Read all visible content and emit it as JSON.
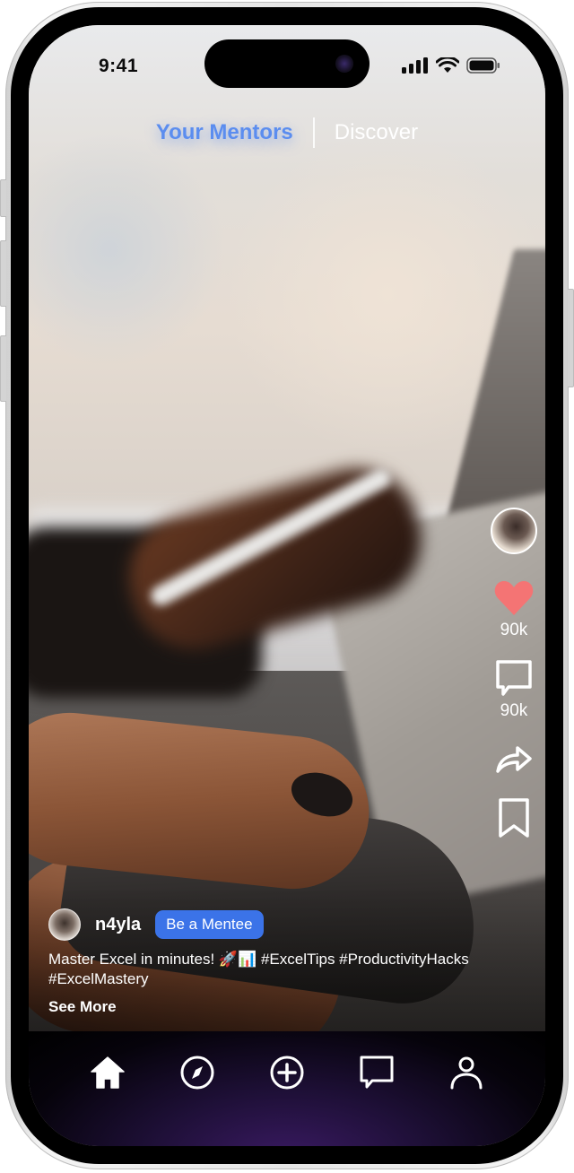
{
  "status_bar": {
    "time": "9:41"
  },
  "top_tabs": [
    {
      "label": "Your Mentors",
      "active": true
    },
    {
      "label": "Discover",
      "active": false
    }
  ],
  "actions": {
    "creator_avatar": "creator-avatar",
    "like": {
      "icon": "heart-icon",
      "count": "90k",
      "color": "#f47474"
    },
    "comment": {
      "icon": "comment-icon",
      "count": "90k"
    },
    "share": {
      "icon": "share-icon"
    },
    "bookmark": {
      "icon": "bookmark-icon"
    }
  },
  "post": {
    "author": "n4yla",
    "follow_button": "Be a Mentee",
    "caption": "Master Excel in minutes! 🚀📊 #ExcelTips #ProductivityHacks #ExcelMastery",
    "see_more": "See More"
  },
  "bottom_nav": [
    {
      "name": "home",
      "icon": "home-icon",
      "active": true
    },
    {
      "name": "discover",
      "icon": "compass-icon"
    },
    {
      "name": "create",
      "icon": "plus-circle-icon"
    },
    {
      "name": "messages",
      "icon": "message-icon"
    },
    {
      "name": "profile",
      "icon": "user-icon"
    }
  ],
  "colors": {
    "accent": "#5b8def",
    "button": "#3b73e8",
    "like": "#f47474"
  }
}
